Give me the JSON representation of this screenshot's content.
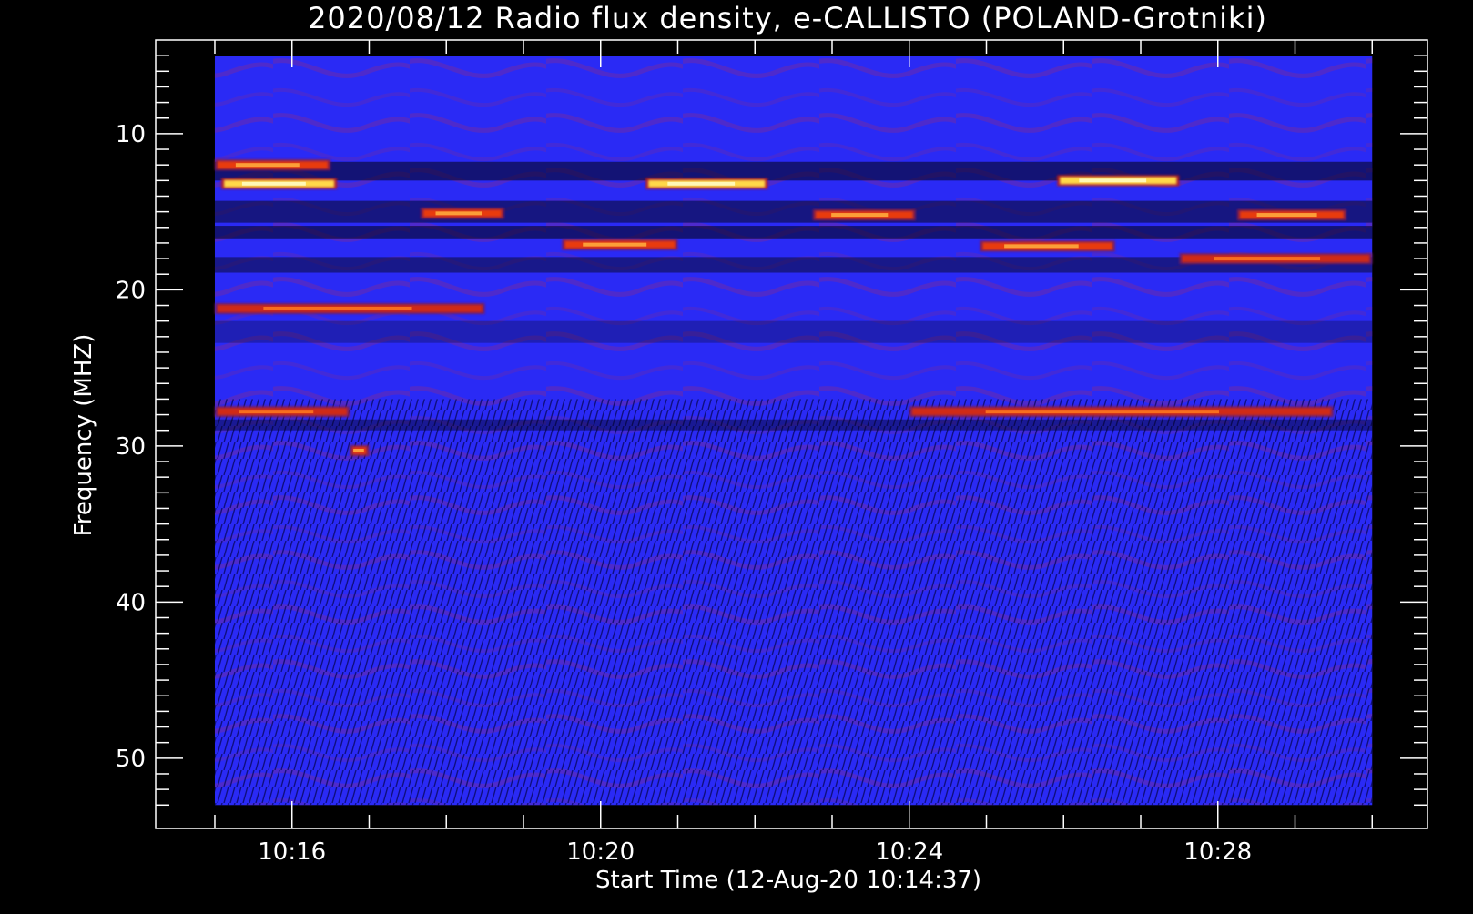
{
  "chart_data": {
    "type": "heatmap",
    "title": "2020/08/12  Radio flux density, e-CALLISTO (POLAND-Grotniki)",
    "xlabel": "Start Time (12-Aug-20 10:14:37)",
    "ylabel": "Frequency (MHZ)",
    "x_range": [
      "10:15:00",
      "10:30:00"
    ],
    "xlim": [
      "10:14:14",
      "10:30:43"
    ],
    "x_ticks": [
      {
        "label": "10:16",
        "time": "10:16:00"
      },
      {
        "label": "10:20",
        "time": "10:20:00"
      },
      {
        "label": "10:24",
        "time": "10:24:00"
      },
      {
        "label": "10:28",
        "time": "10:28:00"
      }
    ],
    "y_range": [
      5,
      53
    ],
    "ylim": [
      4,
      54.5
    ],
    "y_inverted": true,
    "y_ticks": [
      10,
      20,
      30,
      40,
      50
    ],
    "colormap": [
      "#000000",
      "#0a0a5a",
      "#2a2af5",
      "#6a22a0",
      "#b81e1e",
      "#ff5a00",
      "#ffd84a",
      "#ffffc8"
    ],
    "background_color": "#2a2af5",
    "emission_bands": [
      {
        "freq": 12,
        "start": "10:15:00",
        "end": "10:16:30",
        "level": "high"
      },
      {
        "freq": 13.2,
        "start": "10:15:05",
        "end": "10:16:35",
        "level": "very-high"
      },
      {
        "freq": 13.2,
        "start": "10:20:35",
        "end": "10:22:10",
        "level": "very-high"
      },
      {
        "freq": 13,
        "start": "10:25:55",
        "end": "10:27:30",
        "level": "very-high"
      },
      {
        "freq": 15.1,
        "start": "10:17:40",
        "end": "10:18:45",
        "level": "high"
      },
      {
        "freq": 15.2,
        "start": "10:22:45",
        "end": "10:24:05",
        "level": "high"
      },
      {
        "freq": 15.2,
        "start": "10:28:15",
        "end": "10:29:40",
        "level": "high"
      },
      {
        "freq": 17.1,
        "start": "10:19:30",
        "end": "10:21:00",
        "level": "high"
      },
      {
        "freq": 17.2,
        "start": "10:24:55",
        "end": "10:26:40",
        "level": "high"
      },
      {
        "freq": 18.0,
        "start": "10:27:30",
        "end": "10:30:00",
        "level": "medium"
      },
      {
        "freq": 21.2,
        "start": "10:15:00",
        "end": "10:18:30",
        "level": "medium"
      },
      {
        "freq": 27.8,
        "start": "10:15:00",
        "end": "10:16:45",
        "level": "medium"
      },
      {
        "freq": 27.8,
        "start": "10:24:00",
        "end": "10:29:30",
        "level": "medium"
      },
      {
        "freq": 30.3,
        "start": "10:16:45",
        "end": "10:17:00",
        "level": "high"
      }
    ]
  }
}
